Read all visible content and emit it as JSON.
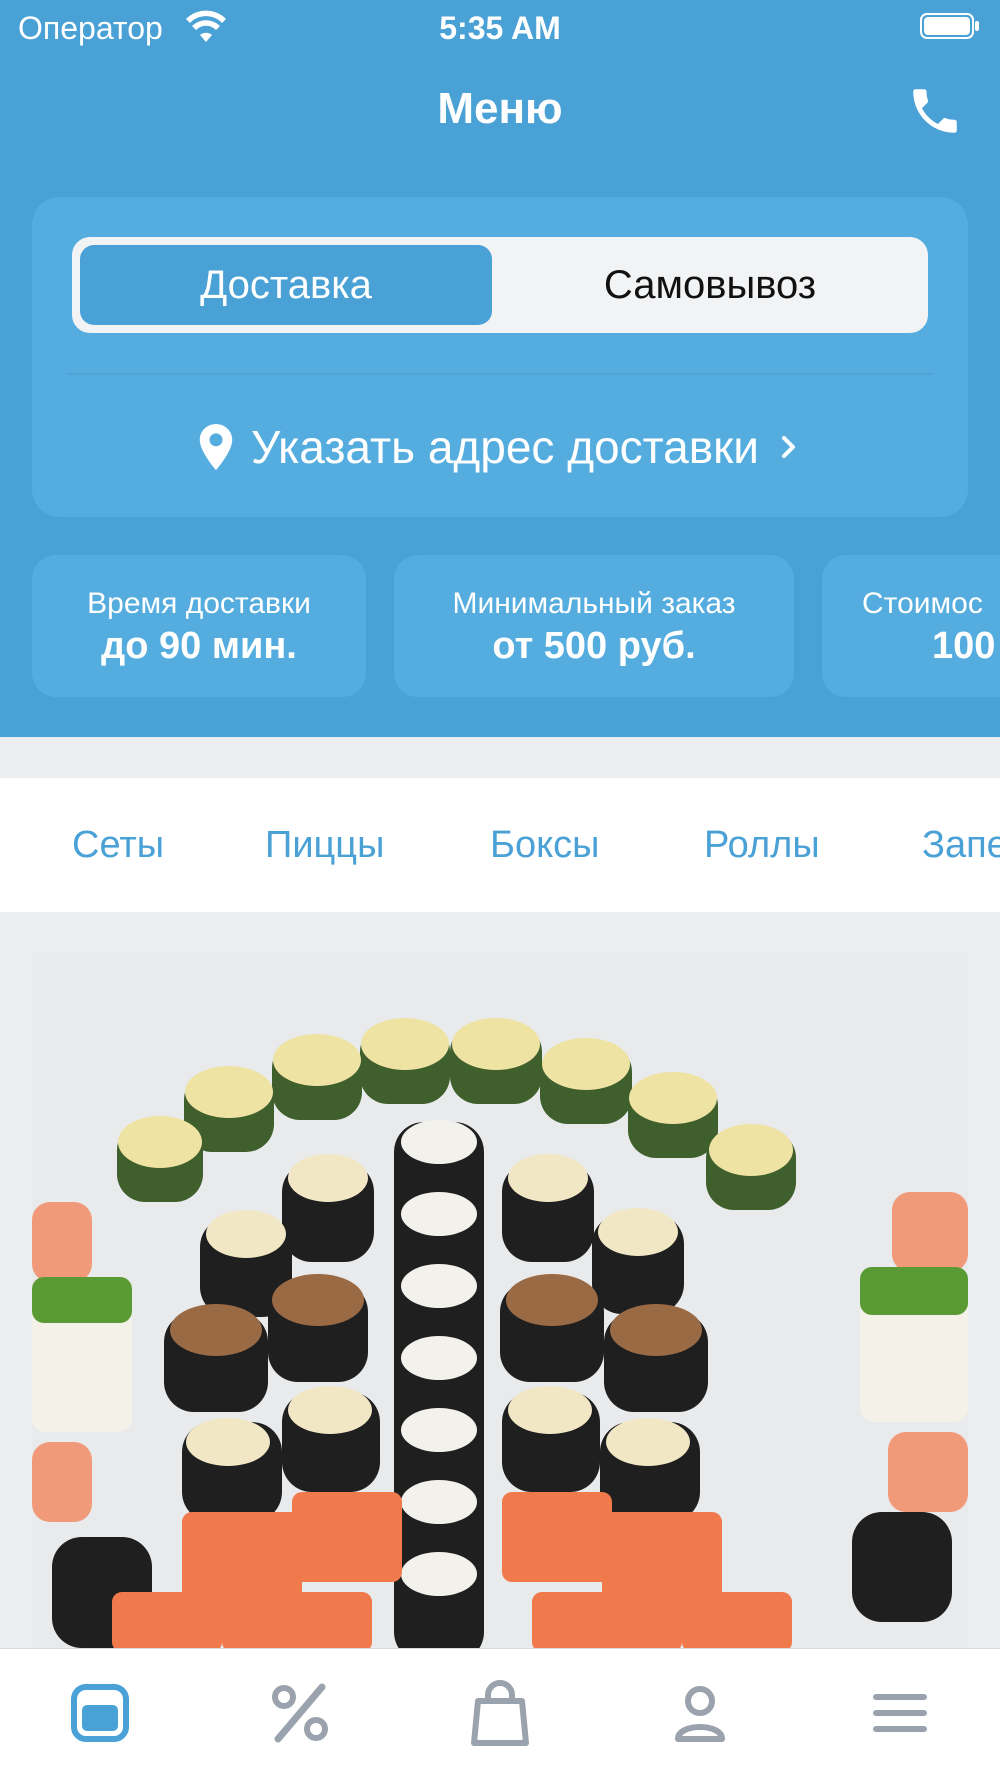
{
  "status_bar": {
    "carrier": "Оператор",
    "time": "5:35 AM"
  },
  "navbar": {
    "title": "Меню",
    "phone_icon": "phone-icon"
  },
  "delivery_mode": {
    "options": [
      "Доставка",
      "Самовывоз"
    ],
    "selected": "Доставка",
    "address_label": "Указать адрес доставки"
  },
  "info_cards": [
    {
      "label": "Время доставки",
      "value": "до 90 мин."
    },
    {
      "label": "Минимальный заказ",
      "value": "от 500 руб."
    },
    {
      "label": "Стоимос",
      "value": "100"
    }
  ],
  "categories": [
    "Сеты",
    "Пиццы",
    "Боксы",
    "Роллы",
    "Запе"
  ],
  "tabbar": {
    "items": [
      "menu-icon",
      "percent-icon",
      "bag-icon",
      "profile-icon",
      "hamburger-icon"
    ],
    "active": "menu-icon"
  },
  "colors": {
    "accent": "#4aa1d6",
    "card": "#55addf",
    "background": "#eceef1"
  }
}
